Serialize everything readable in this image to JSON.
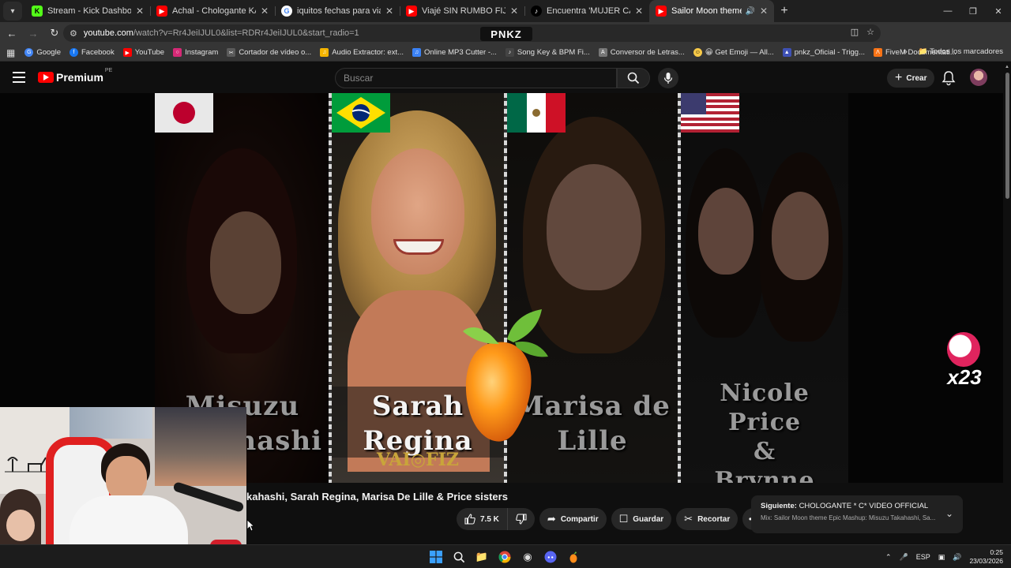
{
  "browser": {
    "tabs": [
      {
        "title": "Stream - Kick Dashboard",
        "icon": "kick-icon",
        "active": false
      },
      {
        "title": "Achal - Chologante KARAOKE (",
        "icon": "youtube-icon",
        "active": false
      },
      {
        "title": "iquitos fechas para viajar - Busc",
        "icon": "google-icon",
        "active": false
      },
      {
        "title": "Viajé SIN RUMBO FIJO al Coraz",
        "icon": "youtube-icon",
        "active": false
      },
      {
        "title": "Encuentra 'MUJER CANTA ORA",
        "icon": "tiktok-icon",
        "active": false
      },
      {
        "title": "Sailor Moon theme Epic Ma",
        "icon": "youtube-icon",
        "active": true
      }
    ],
    "url_host": "youtube.com",
    "url_rest": "/watch?v=Rr4JeiIJUL0&list=RDRr4JeiIJUL0&start_radio=1",
    "overlay_logo": "PNKZ",
    "bookmarks": [
      {
        "label": "Google",
        "color": "#4285f4"
      },
      {
        "label": "Facebook",
        "color": "#1877f2"
      },
      {
        "label": "YouTube",
        "color": "#ff0000"
      },
      {
        "label": "Instagram",
        "color": "#d62976"
      },
      {
        "label": "Cortador de vídeo o...",
        "color": "#5a5a5a"
      },
      {
        "label": "Audio Extractor: ext...",
        "color": "#f4b400"
      },
      {
        "label": "Online MP3 Cutter -...",
        "color": "#3b82f6"
      },
      {
        "label": "Song Key & BPM Fi...",
        "color": "#444444"
      },
      {
        "label": "Conversor de Letras...",
        "color": "#777777"
      },
      {
        "label": "😀 Get Emoji — All...",
        "color": "#f7c948"
      },
      {
        "label": "pnkz_Oficial - Trigg...",
        "color": "#3f51b5"
      },
      {
        "label": "FiveM Documentati...",
        "color": "#f97316"
      }
    ],
    "bookmarks_folder": "Todos los marcadores"
  },
  "youtube": {
    "logo_word": "Premium",
    "logo_region": "PE",
    "search_placeholder": "Buscar",
    "create_label": "Crear",
    "video_title": "kahashi, Sarah Regina, Marisa De Lille & Price sisters",
    "likes": "7.5 K",
    "share_label": "Compartir",
    "save_label": "Guardar",
    "clip_label": "Recortar",
    "next_prefix": "Siguiente:",
    "next_title": "CHOLOGANTE * C* VIDEO OFFICIAL",
    "next_subtitle": "Mix: Sailor Moon theme Epic Mashup: Misuzu Takahashi, Sa..."
  },
  "video": {
    "panels": [
      {
        "name_line1": "Misuzu",
        "name_line2": "Takahashi",
        "flag": "japan"
      },
      {
        "name_line1": "Sarah",
        "name_line2": "Regina",
        "flag": "brazil"
      },
      {
        "name_line1": "Marisa de",
        "name_line2": "Lille",
        "flag": "mexico"
      },
      {
        "name_line1": "Nicole Price",
        "name_line2": "&",
        "name_line3": "Brynne Price",
        "flag": "usa"
      }
    ],
    "watermark": "VAI◎FIZ",
    "like_counter": "x23"
  },
  "taskbar": {
    "language": "ESP",
    "time": "0:25",
    "date": "23/03/2026"
  },
  "colors": {
    "youtube_red": "#ff0000",
    "background": "#0f0f0f",
    "pill": "#272727"
  }
}
